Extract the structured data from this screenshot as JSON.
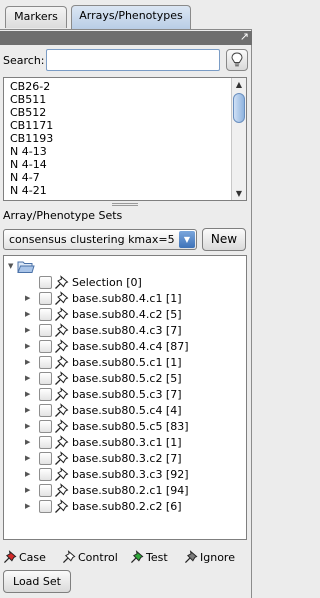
{
  "tabs": [
    {
      "label": "Markers",
      "selected": false
    },
    {
      "label": "Arrays/Phenotypes",
      "selected": true
    }
  ],
  "search": {
    "label": "Search:",
    "value": "",
    "placeholder": ""
  },
  "arrays_list": {
    "items": [
      "CB26-2",
      "CB511",
      "CB512",
      "CB1171",
      "CB1193",
      "N 4-13",
      "N 4-14",
      "N 4-7",
      "N 4-21"
    ]
  },
  "sets": {
    "label": "Array/Phenotype Sets",
    "selected_set": "consensus clustering kmax=5",
    "new_label": "New"
  },
  "tree": {
    "selection_label": "Selection [0]",
    "children": [
      "base.sub80.4.c1 [1]",
      "base.sub80.4.c2 [5]",
      "base.sub80.4.c3 [7]",
      "base.sub80.4.c4 [87]",
      "base.sub80.5.c1 [1]",
      "base.sub80.5.c2 [5]",
      "base.sub80.5.c3 [7]",
      "base.sub80.5.c4 [4]",
      "base.sub80.5.c5 [83]",
      "base.sub80.3.c1 [1]",
      "base.sub80.3.c2 [7]",
      "base.sub80.3.c3 [92]",
      "base.sub80.2.c1 [94]",
      "base.sub80.2.c2 [6]"
    ]
  },
  "legend": [
    {
      "label": "Case",
      "icon": "case-pin-icon",
      "color": "#d42a2a"
    },
    {
      "label": "Control",
      "icon": "control-pin-icon",
      "color": "#ffffff"
    },
    {
      "label": "Test",
      "icon": "test-pin-icon",
      "color": "#2fa83a"
    },
    {
      "label": "Ignore",
      "icon": "ignore-pin-icon",
      "color": "#7a7a7a"
    }
  ],
  "load_set_label": "Load Set",
  "colors": {
    "selected_tab": "#b9cde6",
    "combo_arrow": "#3e72b8",
    "title_strip": "#6e6e6e"
  }
}
